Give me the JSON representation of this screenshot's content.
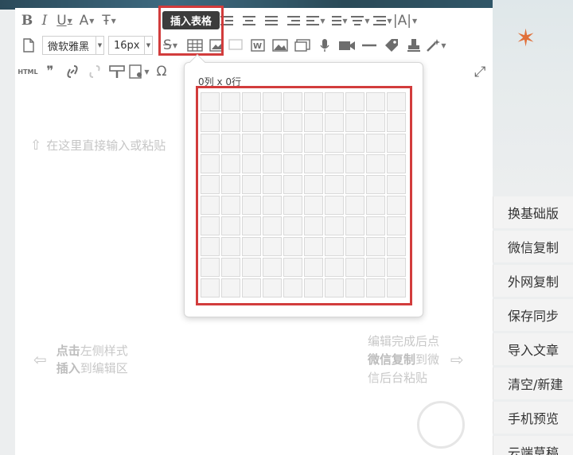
{
  "tooltip": "插入表格",
  "toolbar": {
    "font_family": "微软雅黑",
    "font_size": "16px",
    "html_label": "HTML"
  },
  "editor": {
    "placeholder": "在这里直接输入或粘贴",
    "left_hint_bold1": "点击",
    "left_hint_rest1": "左侧样式",
    "left_hint_bold2": "插入",
    "left_hint_rest2": "到编辑区",
    "right_hint_line1": "编辑完成后点",
    "right_hint_bold": "微信复制",
    "right_hint_rest2": "到微",
    "right_hint_line3": "信后台粘贴"
  },
  "table_picker": {
    "label": "0列 x 0行",
    "columns": 10,
    "rows": 10
  },
  "side_menu": [
    "换基础版",
    "微信复制",
    "外网复制",
    "保存同步",
    "导入文章",
    "清空/新建",
    "手机预览",
    "云端草稿"
  ],
  "icons": {
    "bold": "B",
    "italic": "I",
    "underline": "U",
    "font_color": "A",
    "strike": "S",
    "omega": "Ω"
  },
  "colors": {
    "highlight": "#d23c3c",
    "tooltip_bg": "#3c3c3c"
  }
}
